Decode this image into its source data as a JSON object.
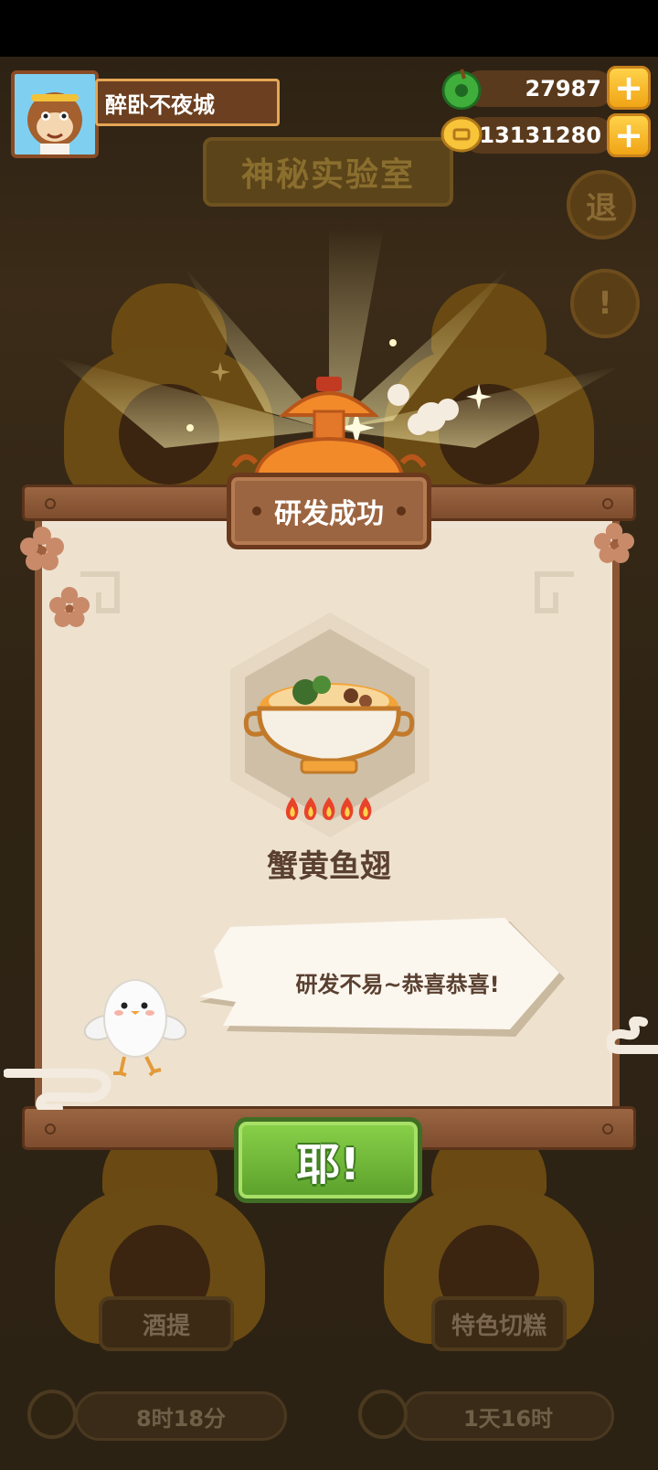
{
  "player": {
    "name": "醉卧不夜城"
  },
  "resources": {
    "jade": "27987",
    "coins": "13131280"
  },
  "scene": {
    "title": "神秘实验室",
    "exit_label": "退",
    "alert_label": "!",
    "slots": [
      {
        "label": "酒提",
        "timer": "8时18分"
      },
      {
        "label": "特色切糕",
        "timer": "1天16时"
      }
    ]
  },
  "dialog": {
    "header": "研发成功",
    "dish_name": "蟹黄鱼翅",
    "flame_rating": 5,
    "speech": "研发不易~恭喜恭喜!",
    "confirm_label": "耶!"
  },
  "colors": {
    "panel": "#efe4d3",
    "wood": "#8a5634",
    "confirm_green": "#6fba3a",
    "gold": "#f5b92a"
  }
}
